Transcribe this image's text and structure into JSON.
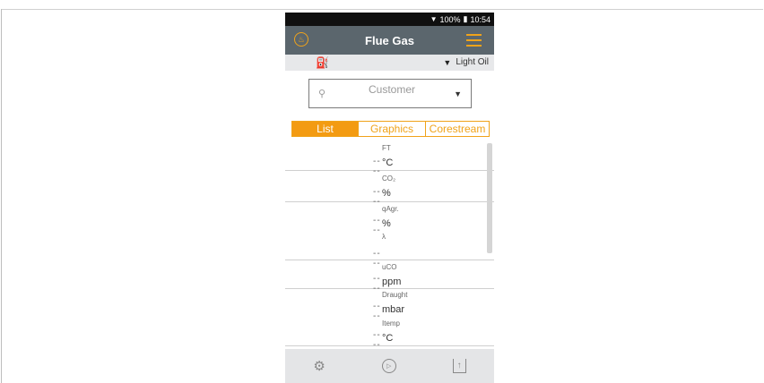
{
  "statusbar": {
    "battery": "100%",
    "time": "10:54"
  },
  "appbar": {
    "title": "Flue Gas"
  },
  "fuel": {
    "selected": "Light Oil"
  },
  "customer": {
    "placeholder": "Customer"
  },
  "tabs": [
    {
      "label": "List",
      "active": true
    },
    {
      "label": "Graphics",
      "active": false
    },
    {
      "label": "Corestream",
      "active": false
    }
  ],
  "parameters": [
    {
      "name": "FT",
      "unit": "°C",
      "value": "----"
    },
    {
      "name": "CO₂",
      "unit": "%",
      "value": "----"
    },
    {
      "name": "qAgr.",
      "unit": "%",
      "value": "----"
    },
    {
      "name": "λ",
      "unit": "",
      "value": "----"
    },
    {
      "name": "uCO",
      "unit": "ppm",
      "value": "----"
    },
    {
      "name": "Draught",
      "unit": "mbar",
      "value": "----"
    },
    {
      "name": "Itemp",
      "unit": "°C",
      "value": "----"
    }
  ],
  "colors": {
    "accent": "#f39b12",
    "appbar": "#5b666d"
  }
}
